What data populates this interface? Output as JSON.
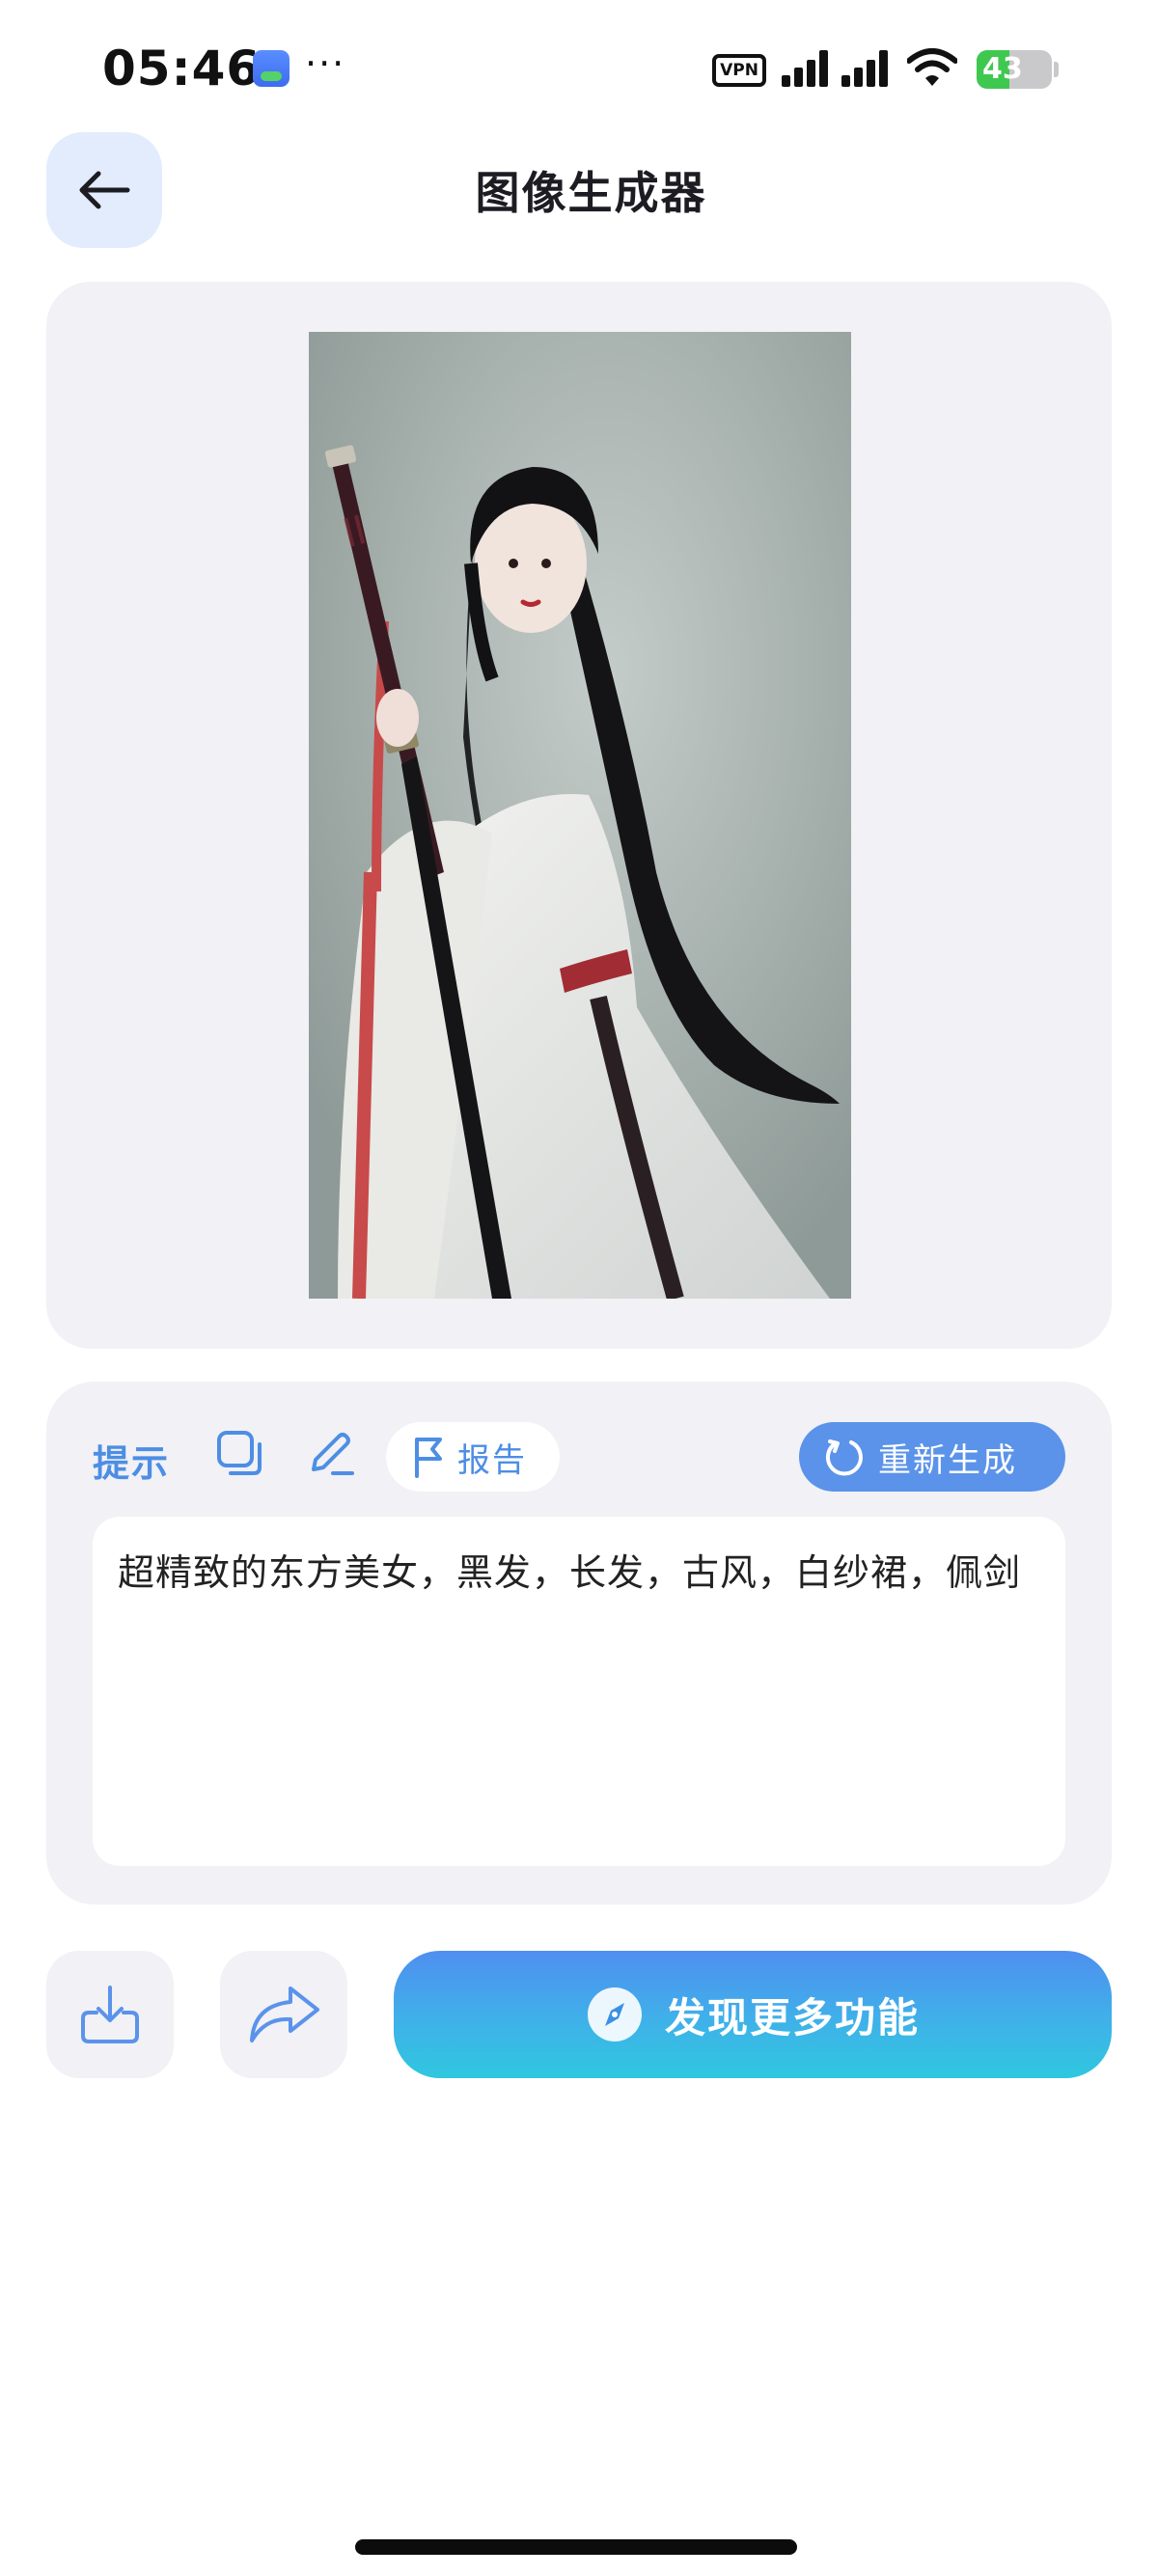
{
  "status_bar": {
    "time": "05:46",
    "more": "···",
    "vpn": "VPN",
    "battery_percent": "43",
    "battery_level": 0.43,
    "icons": [
      "app-notification-icon",
      "vpn-icon",
      "signal-icon",
      "signal-icon",
      "wifi-icon",
      "battery-charging-icon"
    ]
  },
  "header": {
    "title": "图像生成器",
    "back_icon": "arrow-left-icon"
  },
  "image_card": {
    "image_subject": "illustration-woman-with-sword"
  },
  "prompt_card": {
    "label": "提示",
    "tools": [
      "copy-icon",
      "edit-pencil-icon"
    ],
    "report_label": "报告",
    "report_icon": "flag-icon",
    "regenerate_label": "重新生成",
    "regenerate_icon": "refresh-icon",
    "prompt_text": "超精致的东方美女，黑发，长发，古风，白纱裙，佩剑"
  },
  "actions": {
    "download_icon": "download-icon",
    "share_icon": "share-arrow-icon",
    "discover_label": "发现更多功能",
    "discover_icon": "compass-icon"
  },
  "colors": {
    "accent": "#4d8ee4",
    "regen_button": "#5b93ea",
    "card_bg": "#f1f1f6",
    "back_button_bg": "#e3ecfd",
    "discover_gradient_top": "#4f8ff0",
    "discover_gradient_bottom": "#2fc7df",
    "battery_green": "#3fc84f"
  }
}
